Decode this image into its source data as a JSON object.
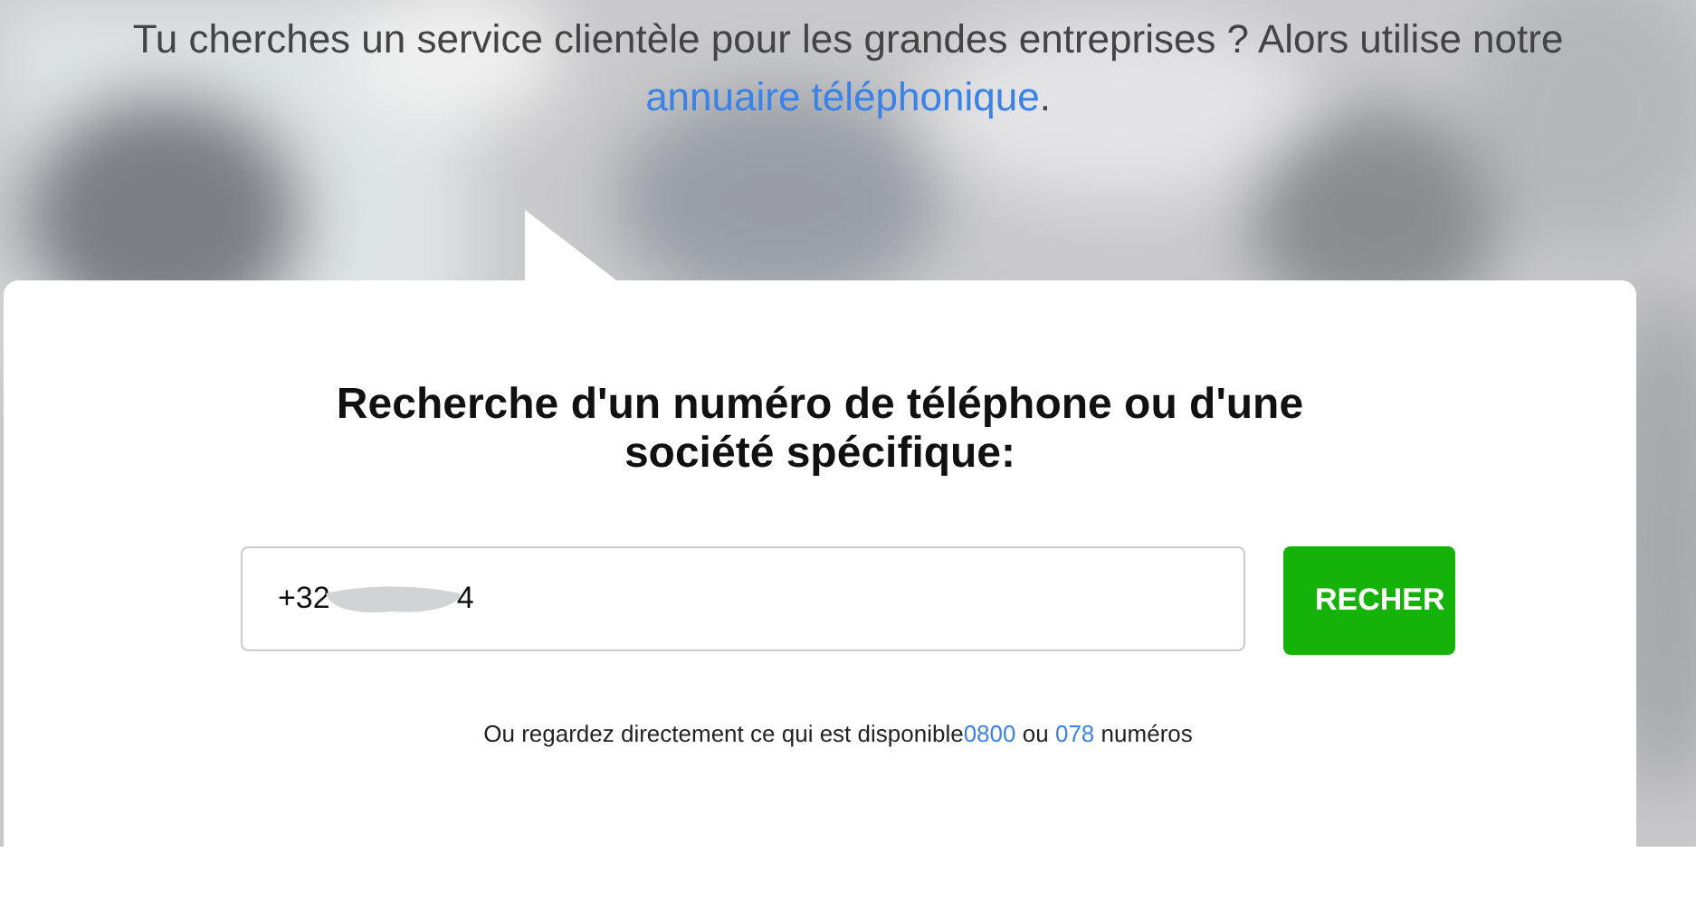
{
  "intro": {
    "text": "Tu cherches un service clientèle pour les grandes entreprises ? Alors utilise notre",
    "link": "annuaire téléphonique",
    "end": "."
  },
  "search": {
    "heading": "Recherche d'un numéro de téléphone ou d'une société spécifique:",
    "value": "+32",
    "value_tail": "4",
    "button": "RECHER"
  },
  "footer_line": {
    "text": "Ou regardez directement ce qui est disponible",
    "link_1": "0800",
    "middle": "ou",
    "link_2": "078",
    "end": "numéros"
  }
}
